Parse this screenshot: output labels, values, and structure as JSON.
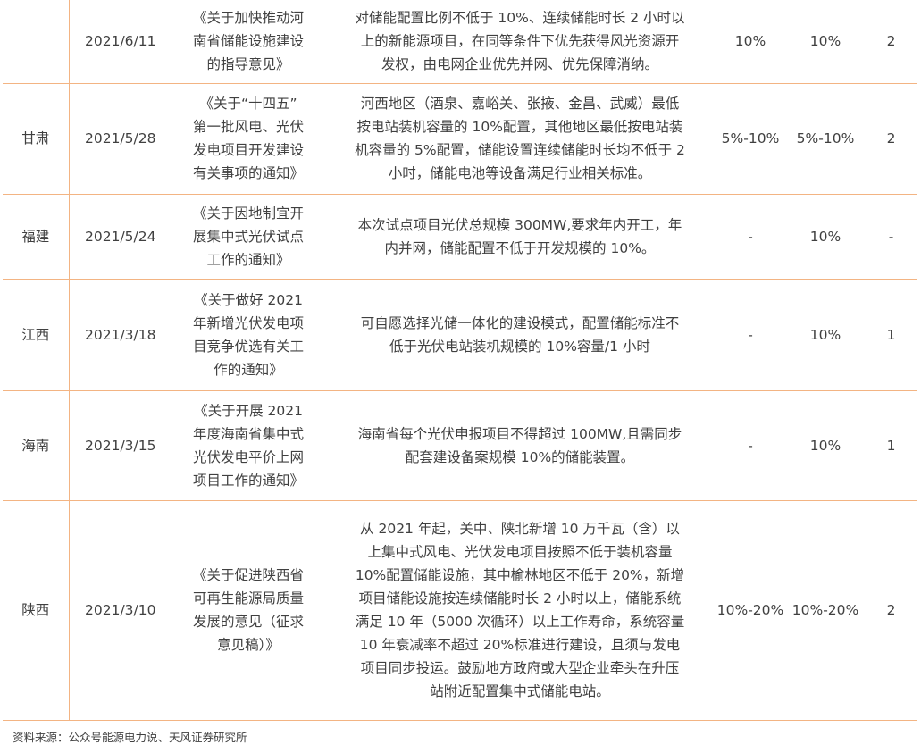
{
  "rows": [
    {
      "province": "",
      "date": "2021/6/11",
      "doc_lines": [
        "《关于加快推动河",
        "南省储能设施建设",
        "的指导意见》"
      ],
      "content_lines": [
        "对储能配置比例不低于 10%、连续储能时长 2 小时以",
        "上的新能源项目，在同等条件下优先获得风光资源开",
        "发权，由电网企业优先并网、优先保障消纳。"
      ],
      "col5": "10%",
      "col6": "10%",
      "col7": "2"
    },
    {
      "province": "甘肃",
      "date": "2021/5/28",
      "doc_lines": [
        "《关于“十四五”",
        "第一批风电、光伏",
        "发电项目开发建设",
        "有关事项的通知》"
      ],
      "content_lines": [
        "河西地区（酒泉、嘉峪关、张掖、金昌、武威）最低",
        "按电站装机容量的 10%配置，其他地区最低按电站装",
        "机容量的 5%配置，储能设置连续储能时长均不低于 2",
        "小时，储能电池等设备满足行业相关标准。"
      ],
      "col5": "5%-10%",
      "col6": "5%-10%",
      "col7": "2"
    },
    {
      "province": "福建",
      "date": "2021/5/24",
      "doc_lines": [
        "《关于因地制宜开",
        "展集中式光伏试点",
        "工作的通知》"
      ],
      "content_lines": [
        "本次试点项目光伏总规模 300MW,要求年内开工，年",
        "内并网，储能配置不低于开发规模的 10%。"
      ],
      "col5": "-",
      "col6": "10%",
      "col7": "-"
    },
    {
      "province": "江西",
      "date": "2021/3/18",
      "doc_lines": [
        "《关于做好 2021",
        "年新增光伏发电项",
        "目竞争优选有关工",
        "作的通知》"
      ],
      "content_lines": [
        "可自愿选择光储一体化的建设模式，配置储能标准不",
        "低于光伏电站装机规模的 10%容量/1 小时"
      ],
      "col5": "-",
      "col6": "10%",
      "col7": "1"
    },
    {
      "province": "海南",
      "date": "2021/3/15",
      "doc_lines": [
        "《关于开展 2021",
        "年度海南省集中式",
        "光伏发电平价上网",
        "项目工作的通知》"
      ],
      "content_lines": [
        "海南省每个光伏申报项目不得超过 100MW,且需同步",
        "配套建设备案规模 10%的储能装置。"
      ],
      "col5": "-",
      "col6": "10%",
      "col7": "1"
    },
    {
      "province": "陕西",
      "date": "2021/3/10",
      "doc_lines": [
        "《关于促进陕西省",
        "可再生能源局质量",
        "发展的意见（征求",
        "意见稿）》"
      ],
      "content_lines": [
        "从 2021 年起，关中、陕北新增 10 万千瓦（含）以",
        "上集中式风电、光伏发电项目按照不低于装机容量",
        "10%配置储能设施，其中榆林地区不低于 20%，新增",
        "项目储能设施按连续储能时长 2 小时以上，储能系统",
        "满足 10 年（5000 次循环）以上工作寿命，系统容量",
        "10 年衰减率不超过 20%标准进行建设，且须与发电",
        "项目同步投运。鼓励地方政府或大型企业牵头在升压",
        "站附近配置集中式储能电站。"
      ],
      "col5": "10%-20%",
      "col6": "10%-20%",
      "col7": "2"
    }
  ],
  "source_note": "资料来源：公众号能源电力说、天风证券研究所"
}
